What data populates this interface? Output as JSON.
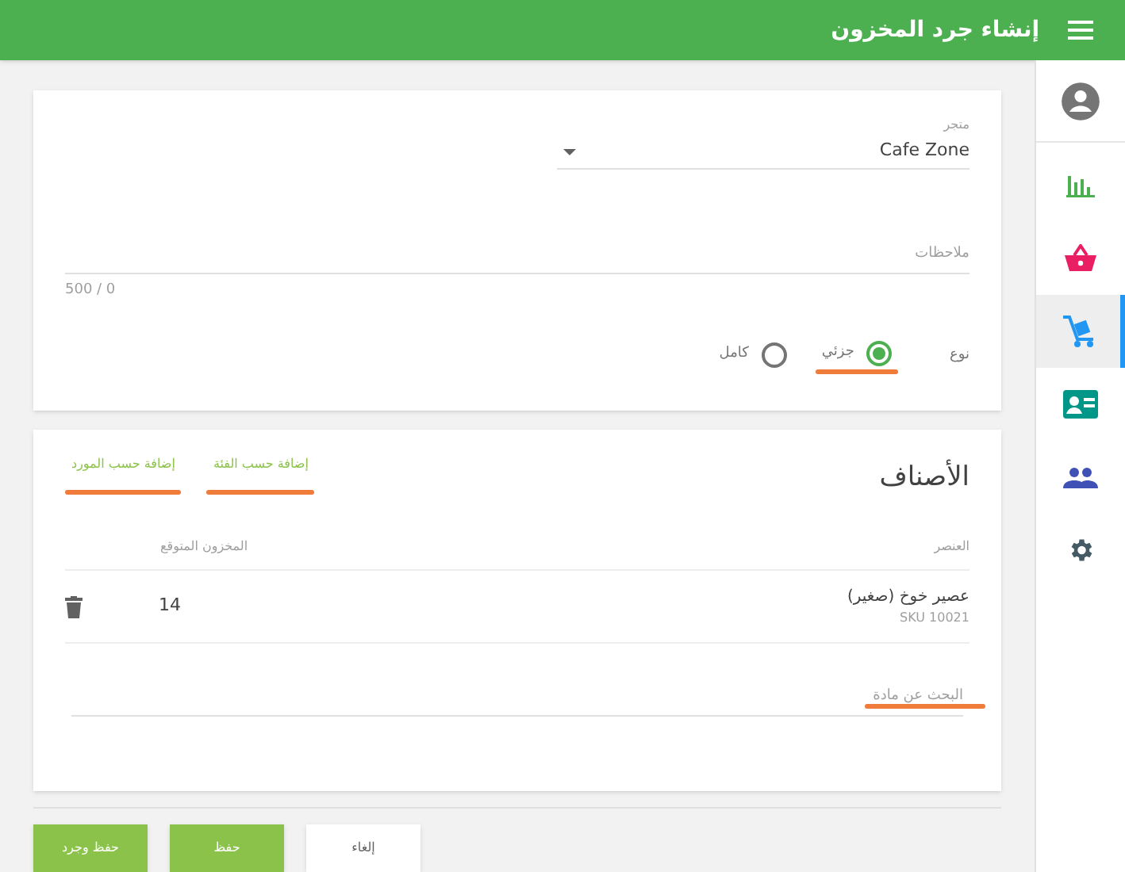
{
  "header": {
    "title": "إنشاء جرد المخزون"
  },
  "sidebar": {
    "items": [
      {
        "kind": "avatar",
        "selected": false
      },
      {
        "kind": "chart",
        "selected": false
      },
      {
        "kind": "basket",
        "selected": false
      },
      {
        "kind": "cart",
        "selected": true
      },
      {
        "kind": "card",
        "selected": false
      },
      {
        "kind": "people",
        "selected": false
      },
      {
        "kind": "settings",
        "selected": false
      }
    ]
  },
  "details": {
    "store": {
      "label": "متجر",
      "value": "Cafe Zone"
    },
    "notes": {
      "placeholder": "ملاحظات",
      "counter": "500 / 0"
    },
    "type": {
      "label": "نوع",
      "options": [
        {
          "label": "جزئي",
          "selected": true,
          "underlined": true
        },
        {
          "label": "كامل",
          "selected": false,
          "underlined": false
        }
      ]
    }
  },
  "items": {
    "title": "الأصناف",
    "links": [
      {
        "label": "إضافة حسب الفئة",
        "underlined": true
      },
      {
        "label": "إضافة حسب المورد",
        "underlined": true
      }
    ],
    "columns": [
      "العنصر",
      "المخزون المتوقع"
    ],
    "rows": [
      {
        "name": "عصير خوخ (صغير)",
        "sku": "SKU 10021",
        "quantity": "14"
      }
    ],
    "search": {
      "placeholder": "البحث عن مادة",
      "underlined": true
    }
  },
  "buttons": [
    {
      "label": "إلغاء",
      "kind": "secondary"
    },
    {
      "label": "حفظ",
      "kind": "primary"
    },
    {
      "label": "حفظ وجرد",
      "kind": "primary"
    }
  ]
}
